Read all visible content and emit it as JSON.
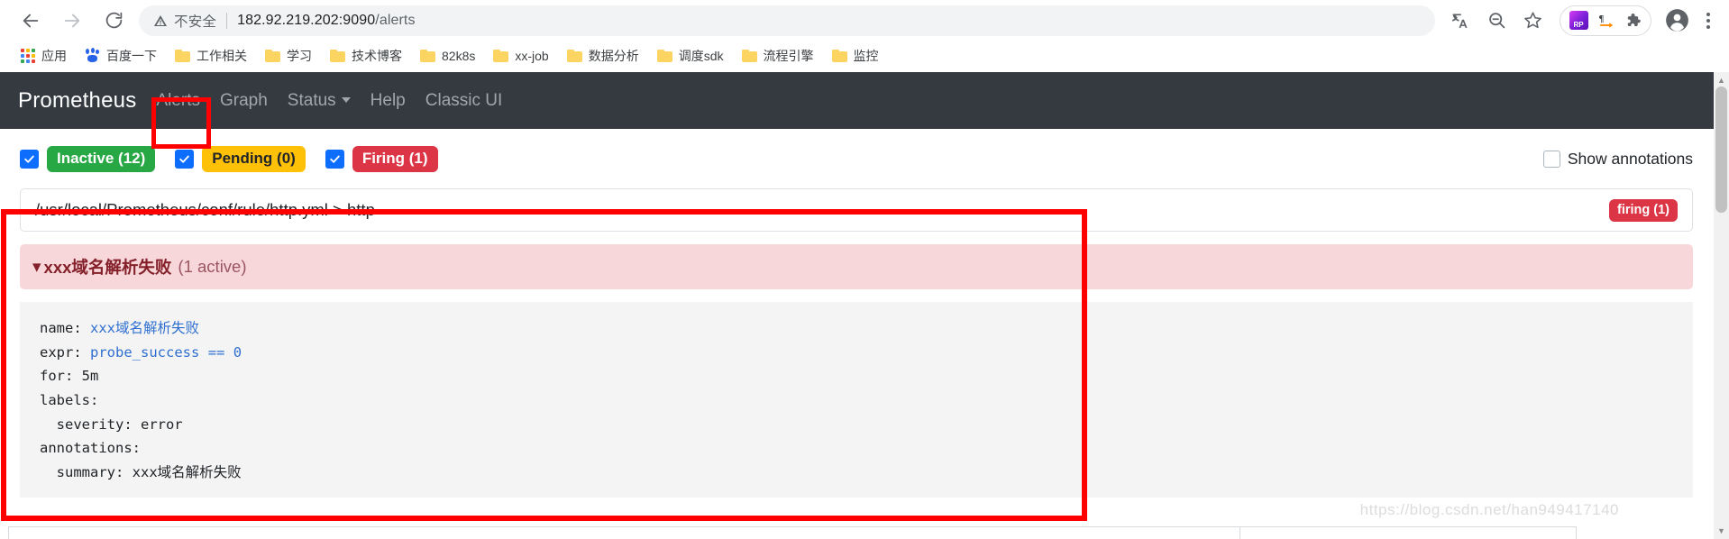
{
  "browser": {
    "back_icon": "back-arrow-icon",
    "forward_icon": "forward-arrow-icon",
    "reload_icon": "reload-icon",
    "security_icon": "warning-triangle-icon",
    "security_text": "不安全",
    "url_host": "182.92.219.202:9090",
    "url_path": "/alerts",
    "url_full": "182.92.219.202:9090/alerts",
    "toolbar_icons": [
      {
        "name": "translate-icon",
        "label": "Translate"
      },
      {
        "name": "zoom-out-icon",
        "label": "Zoom out"
      },
      {
        "name": "bookmark-star-icon",
        "label": "Bookmark this tab"
      }
    ],
    "extensions": [
      {
        "name": "rp-extension-icon",
        "label": "RP"
      },
      {
        "name": "pilcrow-arrow-extension-icon",
        "label": "¶"
      },
      {
        "name": "puzzle-extensions-icon",
        "label": "Extensions"
      }
    ],
    "profile_icon": "profile-avatar-icon",
    "menu_icon": "three-dot-menu-icon"
  },
  "bookmarks": [
    {
      "label": "应用",
      "icon": "apps-grid-icon"
    },
    {
      "label": "百度一下",
      "icon": "baidu-paw-icon"
    },
    {
      "label": "工作相关",
      "icon": "folder-icon"
    },
    {
      "label": "学习",
      "icon": "folder-icon"
    },
    {
      "label": "技术博客",
      "icon": "folder-icon"
    },
    {
      "label": "82k8s",
      "icon": "folder-icon"
    },
    {
      "label": "xx-job",
      "icon": "folder-icon"
    },
    {
      "label": "数据分析",
      "icon": "folder-icon"
    },
    {
      "label": "调度sdk",
      "icon": "folder-icon"
    },
    {
      "label": "流程引擎",
      "icon": "folder-icon"
    },
    {
      "label": "监控",
      "icon": "folder-icon"
    }
  ],
  "prometheus": {
    "brand": "Prometheus",
    "nav": [
      {
        "label": "Alerts",
        "name": "nav-alerts",
        "active": true
      },
      {
        "label": "Graph",
        "name": "nav-graph",
        "active": false
      },
      {
        "label": "Status",
        "name": "nav-status",
        "active": false,
        "has_caret": true
      },
      {
        "label": "Help",
        "name": "nav-help",
        "active": false
      },
      {
        "label": "Classic UI",
        "name": "nav-classic-ui",
        "active": false
      }
    ]
  },
  "filters": {
    "inactive": {
      "label": "Inactive (12)",
      "checked": true,
      "color": "#28a745"
    },
    "pending": {
      "label": "Pending (0)",
      "checked": true,
      "color": "#ffc107"
    },
    "firing": {
      "label": "Firing (1)",
      "checked": true,
      "color": "#dc3545"
    },
    "show_annotations": {
      "label": "Show annotations",
      "checked": false
    }
  },
  "alert_group": {
    "path": "/usr/local/Prometheus/conf/rule/http.yml > http",
    "status_badge": "firing (1)",
    "alert": {
      "chevron": "⌄",
      "name": "xxx域名解析失败",
      "count": "(1 active)",
      "rule": {
        "name_key": "name:",
        "name_value": "xxx域名解析失败",
        "expr_key": "expr:",
        "expr_metric": "probe_success",
        "expr_op": "==",
        "expr_value": "0",
        "for_line": "for: 5m",
        "labels_key": "labels:",
        "labels_severity": "  severity: error",
        "annotations_key": "annotations:",
        "annotations_summary": "  summary: xxx域名解析失败"
      }
    }
  },
  "watermark": "https://blog.csdn.net/han949417140"
}
